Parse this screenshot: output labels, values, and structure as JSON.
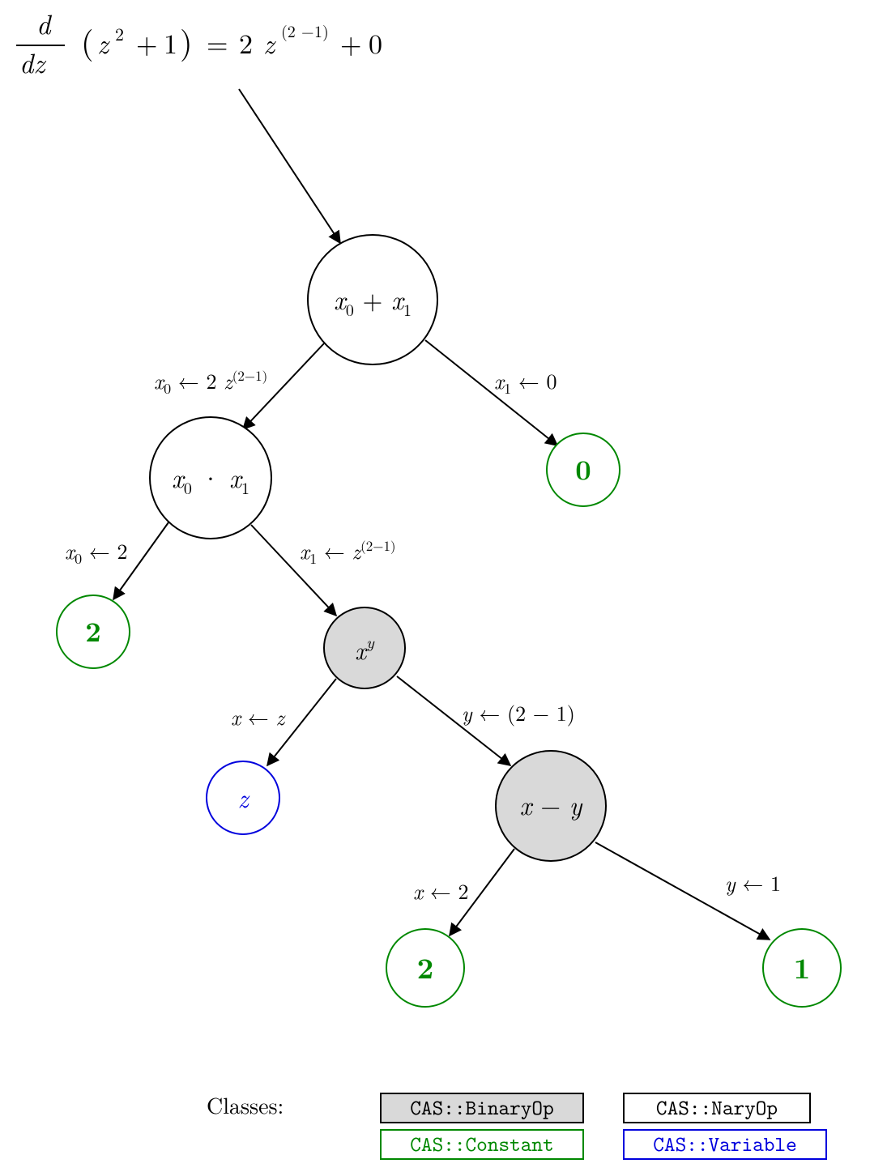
{
  "nodes": {
    "sum": {
      "label_x0": "x",
      "label_sub0": "0",
      "label_plus": "+",
      "label_x1": "x",
      "label_sub1": "1"
    },
    "prod": {
      "label_x0": "x",
      "label_sub0": "0",
      "label_dot": "·",
      "label_x1": "x",
      "label_sub1": "1"
    },
    "pow": {
      "base": "x",
      "exp": "y"
    },
    "minus": {
      "x": "x",
      "minus": "−",
      "y": "y"
    },
    "zero": {
      "v": "0"
    },
    "two_a": {
      "v": "2"
    },
    "z": {
      "v": "z"
    },
    "two_b": {
      "v": "2"
    },
    "one": {
      "v": "1"
    }
  },
  "edges": {
    "sum_prod": {
      "x": "x",
      "sub": "0",
      "arrow": "←",
      "rhs_pre": "2",
      "rhs_z": "z",
      "rhs_lp": "(2",
      "rhs_minus": "−",
      "rhs_rp": "1)"
    },
    "sum_zero": {
      "x": "x",
      "sub": "1",
      "arrow": "←",
      "rhs": "0"
    },
    "prod_two": {
      "x": "x",
      "sub": "0",
      "arrow": "←",
      "rhs": "2"
    },
    "prod_pow": {
      "x": "x",
      "sub": "1",
      "arrow": "←",
      "rhs_z": "z",
      "rhs_lp": "(2",
      "rhs_minus": "−",
      "rhs_rp": "1)"
    },
    "pow_z": {
      "x": "x",
      "arrow": "←",
      "rhs": "z"
    },
    "pow_minus": {
      "y": "y",
      "arrow": "←",
      "rhs_lp": "(2",
      "rhs_minus": "−",
      "rhs_rp": "1)"
    },
    "minus_two": {
      "x": "x",
      "arrow": "←",
      "rhs": "2"
    },
    "minus_one": {
      "y": "y",
      "arrow": "←",
      "rhs": "1"
    }
  },
  "legend": {
    "title": "Classes:",
    "binary": "CAS::BinaryOp",
    "nary": "CAS::NaryOp",
    "const": "CAS::Constant",
    "var": "CAS::Variable"
  }
}
